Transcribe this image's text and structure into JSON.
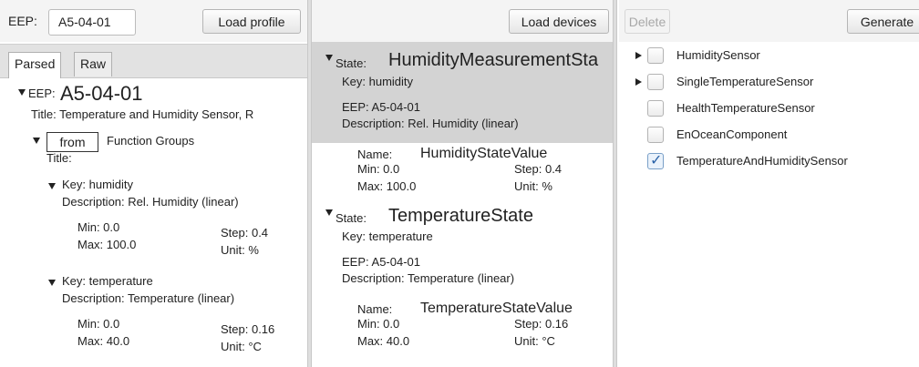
{
  "left": {
    "eep_label": "EEP:",
    "eep_value": "A5-04-01",
    "load_profile_button": "Load profile",
    "tabs": [
      {
        "label": "Parsed"
      },
      {
        "label": "Raw"
      }
    ],
    "tree": {
      "eep_label": "EEP:",
      "eep_value": "A5-04-01",
      "title": "Title:  Temperature and Humidity Sensor, R",
      "from_label": "from",
      "function_groups": "Function Groups",
      "fg_title": "Title:",
      "fields": [
        {
          "key": "Key: humidity",
          "description": "Description: Rel. Humidity (linear)",
          "min": "Min: 0.0",
          "max": "Max:  100.0",
          "step": "Step: 0.4",
          "unit": "Unit:  %"
        },
        {
          "key": "Key: temperature",
          "description": "Description: Temperature (linear)",
          "min": "Min: 0.0",
          "max": "Max:  40.0",
          "step": "Step: 0.16",
          "unit": "Unit:  °C"
        }
      ]
    }
  },
  "middle": {
    "load_devices_button": "Load devices",
    "states": [
      {
        "state_label": "State:",
        "state_name": "HumidityMeasurementSta",
        "key": "Key: humidity",
        "eep": "EEP: A5-04-01",
        "description": "Description: Rel. Humidity (linear)",
        "name_label": "Name:",
        "name_value": "HumidityStateValue",
        "min": "Min: 0.0",
        "max": "Max:  100.0",
        "step": "Step: 0.4",
        "unit": "Unit:  %"
      },
      {
        "state_label": "State:",
        "state_name": "TemperatureState",
        "key": "Key: temperature",
        "eep": "EEP: A5-04-01",
        "description": "Description: Temperature (linear)",
        "name_label": "Name:",
        "name_value": "TemperatureStateValue",
        "min": "Min: 0.0",
        "max": "Max:  40.0",
        "step": "Step: 0.16",
        "unit": "Unit:  °C"
      }
    ]
  },
  "right": {
    "delete_button": "Delete",
    "generate_button": "Generate",
    "items": [
      {
        "label": "HumiditySensor",
        "expandable": true,
        "checked": false
      },
      {
        "label": "SingleTemperatureSensor",
        "expandable": true,
        "checked": false
      },
      {
        "label": "HealthTemperatureSensor",
        "expandable": false,
        "checked": false
      },
      {
        "label": "EnOceanComponent",
        "expandable": false,
        "checked": false
      },
      {
        "label": "TemperatureAndHumiditySensor",
        "expandable": false,
        "checked": true
      }
    ]
  },
  "icons": {
    "expanded": "triangle-down-icon",
    "collapsed": "triangle-right-icon",
    "check": "checkmark-icon"
  },
  "colors": {
    "selection": "#d3d3d3",
    "toolbar": "#f4f4f4",
    "check": "#2a62a8"
  }
}
